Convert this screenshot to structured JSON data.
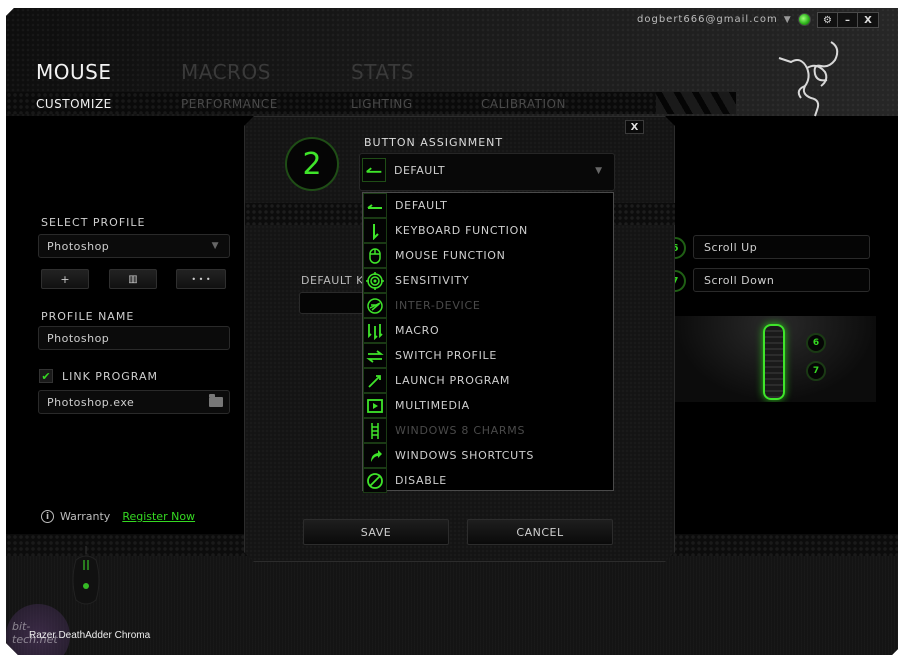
{
  "account": {
    "email": "dogbert666@gmail.com",
    "status": "online"
  },
  "window_controls": {
    "settings": "⚙",
    "minimize": "–",
    "close": "X"
  },
  "main_tabs": [
    {
      "label": "MOUSE",
      "active": true
    },
    {
      "label": "MACROS",
      "active": false
    },
    {
      "label": "STATS",
      "active": false
    }
  ],
  "sub_tabs": [
    {
      "label": "CUSTOMIZE",
      "active": true
    },
    {
      "label": "PERFORMANCE",
      "active": false
    },
    {
      "label": "LIGHTING",
      "active": false
    },
    {
      "label": "CALIBRATION",
      "active": false
    }
  ],
  "profile": {
    "select_label": "SELECT PROFILE",
    "selected": "Photoshop",
    "add_button": "+",
    "delete_button": "🗑",
    "more_button": "• • •",
    "name_label": "PROFILE NAME",
    "name_value": "Photoshop",
    "link_program_label": "LINK PROGRAM",
    "link_program_checked": true,
    "program_value": "Photoshop.exe"
  },
  "warranty": {
    "label": "Warranty",
    "link": "Register Now"
  },
  "device": {
    "name": "Razer DeathAdder Chroma"
  },
  "watermark": "bit-tech.net",
  "right_panel": {
    "bindings": [
      {
        "button": "6",
        "value": "Scroll Up"
      },
      {
        "button": "7",
        "value": "Scroll Down"
      }
    ],
    "preview_badges": [
      "6",
      "7"
    ]
  },
  "modal": {
    "close": "X",
    "button_number": "2",
    "title": "BUTTON ASSIGNMENT",
    "selected": "DEFAULT",
    "default_key_label": "DEFAULT K",
    "options": [
      {
        "label": "DEFAULT",
        "icon": "default-arrow-icon",
        "disabled": false
      },
      {
        "label": "KEYBOARD FUNCTION",
        "icon": "keyboard-function-icon",
        "disabled": false
      },
      {
        "label": "MOUSE FUNCTION",
        "icon": "mouse-icon",
        "disabled": false
      },
      {
        "label": "SENSITIVITY",
        "icon": "target-icon",
        "disabled": false
      },
      {
        "label": "INTER-DEVICE",
        "icon": "inter-device-icon",
        "disabled": true
      },
      {
        "label": "MACRO",
        "icon": "macro-icon",
        "disabled": false
      },
      {
        "label": "SWITCH PROFILE",
        "icon": "switch-arrows-icon",
        "disabled": false
      },
      {
        "label": "LAUNCH PROGRAM",
        "icon": "launch-icon",
        "disabled": false
      },
      {
        "label": "MULTIMEDIA",
        "icon": "play-icon",
        "disabled": false
      },
      {
        "label": "WINDOWS 8 CHARMS",
        "icon": "charms-icon",
        "disabled": true
      },
      {
        "label": "WINDOWS SHORTCUTS",
        "icon": "shortcut-arrow-icon",
        "disabled": false
      },
      {
        "label": "DISABLE",
        "icon": "disable-icon",
        "disabled": false
      }
    ],
    "save": "SAVE",
    "cancel": "CANCEL"
  },
  "colors": {
    "accent": "#35d822",
    "background": "#000000",
    "panel": "#141414"
  }
}
